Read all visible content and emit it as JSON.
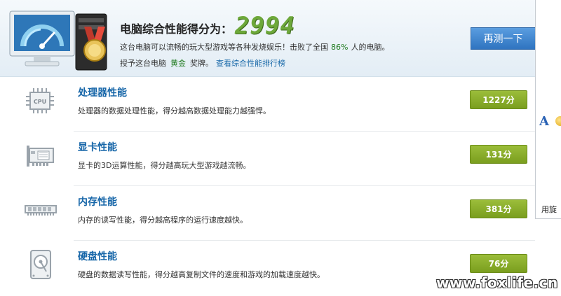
{
  "header": {
    "score_label": "电脑综合性能得分为：",
    "score_value": "2994",
    "desc_prefix": "这台电脑可以流畅的玩大型游戏等各种发烧娱乐！击败了全国",
    "desc_percent": "86%",
    "desc_suffix": "人的电脑。",
    "award_prefix": "授予这台电脑",
    "award_level": "黄金",
    "award_suffix": "奖牌。",
    "rank_link": "查看综合性能排行榜",
    "retest_label": "再测一下"
  },
  "rows": [
    {
      "icon": "cpu-icon",
      "title": "处理器性能",
      "desc": "处理器的数据处理性能，得分越高数据处理能力越强悍。",
      "score": "1227分"
    },
    {
      "icon": "graphics-card-icon",
      "title": "显卡性能",
      "desc": "显卡的3D运算性能，得分越高玩大型游戏越流畅。",
      "score": "131分"
    },
    {
      "icon": "memory-icon",
      "title": "内存性能",
      "desc": "内存的读写性能，得分越高程序的运行速度越快。",
      "score": "381分"
    },
    {
      "icon": "hard-disk-icon",
      "title": "硬盘性能",
      "desc": "硬盘的数据读写性能，得分越高复制文件的速度和游戏的加载速度越快。",
      "score": "76分"
    }
  ],
  "side": {
    "letter": "A",
    "text": "用旋"
  },
  "watermark": "www.foxlife.cn",
  "colors": {
    "score_green": "#6da83a",
    "badge_green": "#8cb02c",
    "title_blue": "#1565a8",
    "button_blue": "#3f86d0"
  }
}
